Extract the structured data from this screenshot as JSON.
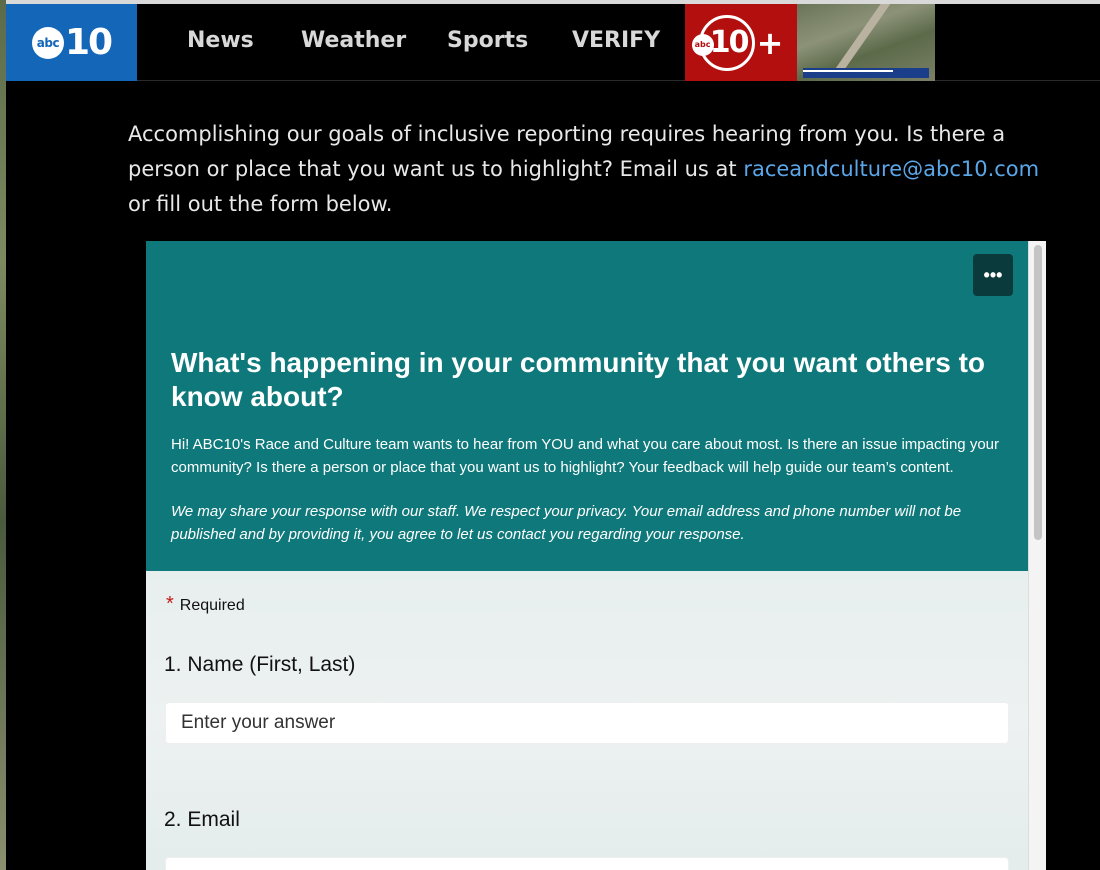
{
  "nav": {
    "logo_abc": "abc",
    "logo_num": "10",
    "items": [
      "News",
      "Weather",
      "Sports",
      "VERIFY"
    ],
    "plus_abc": "abc",
    "plus_num": "10",
    "plus_sign": "+",
    "accent_blue": "#1466b8",
    "accent_red": "#b30f0f"
  },
  "intro": {
    "before_link": "Accomplishing our goals of inclusive reporting requires hearing from you. Is there a person or place that you want us to highlight? Email us at ",
    "link": "raceandculture@abc10.com",
    "after_link": " or fill out the form below."
  },
  "form": {
    "menu_icon": "more-horizontal-icon",
    "title": "What's happening in your community that you want others to know about?",
    "description": "Hi! ABC10's Race and Culture team wants to hear from YOU and what you care about most. Is there an issue impacting your community? Is there a person or place that you want us to highlight? Your feedback will help guide our team’s content.",
    "privacy": "We may share your response with our staff. We respect your privacy. Your email address and phone number will not be published and by providing it, you agree to let us contact you regarding your response.",
    "required_star": "*",
    "required_label": "Required",
    "questions": [
      {
        "number": "1.",
        "label": "Name (First, Last)",
        "placeholder": "Enter your answer"
      },
      {
        "number": "2.",
        "label": "Email",
        "placeholder": ""
      }
    ],
    "header_color": "#0f787a"
  }
}
